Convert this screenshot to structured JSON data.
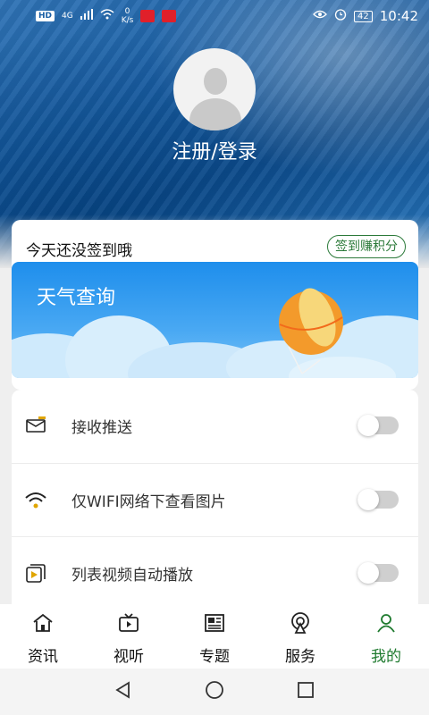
{
  "status_bar": {
    "hd_badge": "HD",
    "network": "4G",
    "speed_value": "0",
    "speed_unit": "K/s",
    "battery": "42",
    "time": "10:42",
    "icons": [
      "eye-icon",
      "alarm-icon",
      "battery-icon"
    ]
  },
  "profile": {
    "login_label": "注册/登录"
  },
  "signin": {
    "text": "今天还没签到哦",
    "button": "签到赚积分"
  },
  "weather": {
    "title": "天气查询"
  },
  "settings": [
    {
      "label": "接收推送",
      "icon": "envelope-icon",
      "enabled": false
    },
    {
      "label": "仅WIFI网络下查看图片",
      "icon": "wifi-icon",
      "enabled": false
    },
    {
      "label": "列表视频自动播放",
      "icon": "video-play-icon",
      "enabled": false
    }
  ],
  "tabs": [
    {
      "label": "资讯",
      "icon": "home-icon",
      "active": false
    },
    {
      "label": "视听",
      "icon": "tv-icon",
      "active": false
    },
    {
      "label": "专题",
      "icon": "newspaper-icon",
      "active": false
    },
    {
      "label": "服务",
      "icon": "broadcast-icon",
      "active": false
    },
    {
      "label": "我的",
      "icon": "user-icon",
      "active": true
    }
  ],
  "colors": {
    "accent": "#1e7a2e",
    "toggle_off": "#cfcfcf",
    "weather_blue": "#1e8eec"
  }
}
